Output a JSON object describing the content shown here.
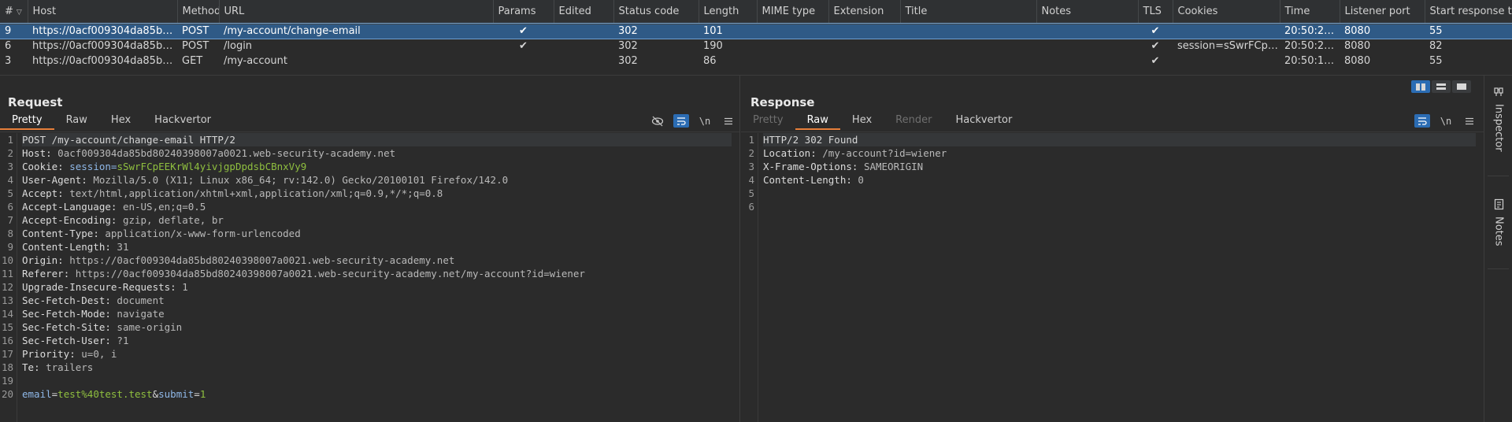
{
  "history": {
    "columns": [
      "#",
      "Host",
      "Method",
      "URL",
      "Params",
      "Edited",
      "Status code",
      "Length",
      "MIME type",
      "Extension",
      "Title",
      "Notes",
      "TLS",
      "Cookies",
      "Time",
      "Listener port",
      "Start response ti"
    ],
    "rows": [
      {
        "num": "9",
        "host": "https://0acf009304da85bd...",
        "method": "POST",
        "url": "/my-account/change-email",
        "params": "✔",
        "edited": "",
        "status": "302",
        "length": "101",
        "mime": "",
        "ext": "",
        "title": "",
        "notes": "",
        "tls": "✔",
        "cookies": "",
        "time": "20:50:24 ...",
        "port": "8080",
        "start": "55",
        "selected": true
      },
      {
        "num": "6",
        "host": "https://0acf009304da85bd...",
        "method": "POST",
        "url": "/login",
        "params": "✔",
        "edited": "",
        "status": "302",
        "length": "190",
        "mime": "",
        "ext": "",
        "title": "",
        "notes": "",
        "tls": "✔",
        "cookies": "session=sSwrFCpE...",
        "time": "20:50:21 1...",
        "port": "8080",
        "start": "82",
        "selected": false
      },
      {
        "num": "3",
        "host": "https://0acf009304da85bd...",
        "method": "GET",
        "url": "/my-account",
        "params": "",
        "edited": "",
        "status": "302",
        "length": "86",
        "mime": "",
        "ext": "",
        "title": "",
        "notes": "",
        "tls": "✔",
        "cookies": "",
        "time": "20:50:19 1...",
        "port": "8080",
        "start": "55",
        "selected": false
      }
    ]
  },
  "request": {
    "title": "Request",
    "tabs": [
      "Pretty",
      "Raw",
      "Hex",
      "Hackvertor"
    ],
    "active_tab": "Pretty",
    "line_numbers": [
      "1",
      "2",
      "3",
      "4",
      "5",
      "6",
      "7",
      "8",
      "9",
      "10",
      "11",
      "12",
      "13",
      "14",
      "15",
      "16",
      "17",
      "18",
      "19",
      "20"
    ],
    "request_line": "POST /my-account/change-email HTTP/2",
    "headers": [
      {
        "name": "Host",
        "value": "0acf009304da85bd80240398007a0021.web-security-academy.net"
      },
      {
        "name": "Cookie",
        "value": "session=sSwrFCpEEKrWl4yivjgpDpdsbCBnxVy9"
      },
      {
        "name": "User-Agent",
        "value": "Mozilla/5.0 (X11; Linux x86_64; rv:142.0) Gecko/20100101 Firefox/142.0"
      },
      {
        "name": "Accept",
        "value": "text/html,application/xhtml+xml,application/xml;q=0.9,*/*;q=0.8"
      },
      {
        "name": "Accept-Language",
        "value": "en-US,en;q=0.5"
      },
      {
        "name": "Accept-Encoding",
        "value": "gzip, deflate, br"
      },
      {
        "name": "Content-Type",
        "value": "application/x-www-form-urlencoded"
      },
      {
        "name": "Content-Length",
        "value": "31"
      },
      {
        "name": "Origin",
        "value": "https://0acf009304da85bd80240398007a0021.web-security-academy.net"
      },
      {
        "name": "Referer",
        "value": "https://0acf009304da85bd80240398007a0021.web-security-academy.net/my-account?id=wiener"
      },
      {
        "name": "Upgrade-Insecure-Requests",
        "value": "1"
      },
      {
        "name": "Sec-Fetch-Dest",
        "value": "document"
      },
      {
        "name": "Sec-Fetch-Mode",
        "value": "navigate"
      },
      {
        "name": "Sec-Fetch-Site",
        "value": "same-origin"
      },
      {
        "name": "Sec-Fetch-User",
        "value": "?1"
      },
      {
        "name": "Priority",
        "value": "u=0, i"
      },
      {
        "name": "Te",
        "value": "trailers"
      }
    ],
    "cookie_name": "session=",
    "cookie_value": "sSwrFCpEEKrWl4yivjgpDpdsbCBnxVy9",
    "body": {
      "k1": "email",
      "v1": "test%40test.test",
      "k2": "submit",
      "v2": "1"
    }
  },
  "response": {
    "title": "Response",
    "tabs": [
      "Pretty",
      "Raw",
      "Hex",
      "Render",
      "Hackvertor"
    ],
    "active_tab": "Raw",
    "line_numbers": [
      "1",
      "2",
      "3",
      "4",
      "5",
      "6"
    ],
    "status_line": "HTTP/2 302 Found",
    "headers": [
      {
        "name": "Location",
        "value": "/my-account?id=wiener"
      },
      {
        "name": "X-Frame-Options",
        "value": "SAMEORIGIN"
      },
      {
        "name": "Content-Length",
        "value": "0"
      }
    ]
  },
  "toolbar": {
    "newline_label": "\\n"
  },
  "sidebar": {
    "inspector": "Inspector",
    "notes": "Notes"
  },
  "colors": {
    "selection": "#2f5a86",
    "accent_tab": "#e67e3a",
    "toggle_on": "#2b6cb3",
    "cookie_value": "#8fbf3f"
  }
}
